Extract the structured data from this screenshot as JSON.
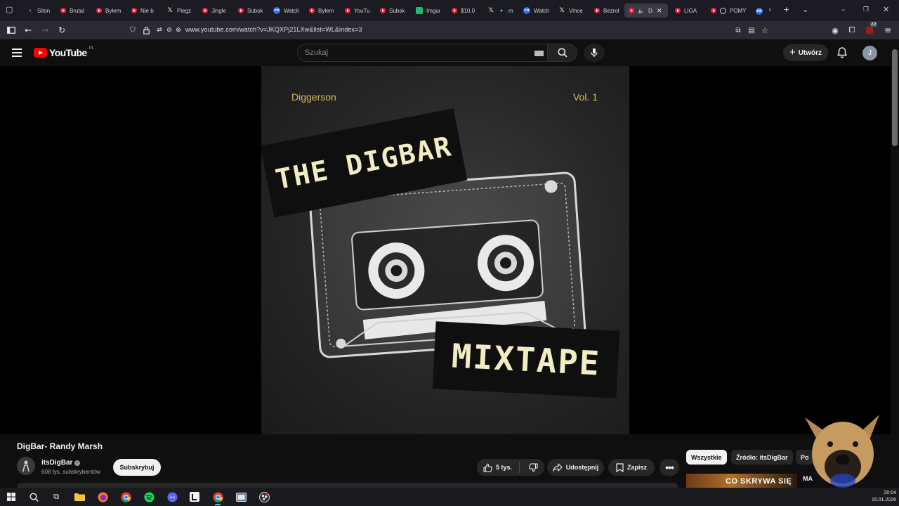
{
  "browser": {
    "tabs": [
      {
        "label": "Siton",
        "icon": "back-chevron"
      },
      {
        "label": "Brutal",
        "icon": "youtube-icon"
      },
      {
        "label": "Byłem",
        "icon": "youtube-icon"
      },
      {
        "label": "Nie b",
        "icon": "youtube-icon"
      },
      {
        "label": "Piegz",
        "icon": "x-icon"
      },
      {
        "label": "Jingle",
        "icon": "youtube-icon"
      },
      {
        "label": "Subsk",
        "icon": "youtube-icon"
      },
      {
        "label": "Watch",
        "icon": "extension-icon"
      },
      {
        "label": "Byłem",
        "icon": "youtube-icon"
      },
      {
        "label": "YouTu",
        "icon": "youtube-icon"
      },
      {
        "label": "Subsk",
        "icon": "youtube-icon"
      },
      {
        "label": "Imgur",
        "icon": "imgur-icon"
      },
      {
        "label": "$10,0",
        "icon": "youtube-icon"
      },
      {
        "label": "m",
        "icon": "x-icon"
      },
      {
        "label": "Watch",
        "icon": "extension-icon"
      },
      {
        "label": "Vince",
        "icon": "x-icon"
      },
      {
        "label": "Bezroł",
        "icon": "youtube-icon"
      },
      {
        "label": "D",
        "icon": "youtube-icon"
      },
      {
        "label": "LIGA",
        "icon": "youtube-icon"
      },
      {
        "label": "POMY",
        "icon": "youtube-icon"
      }
    ],
    "url": "www.youtube.com/watch?v=JKQXPj21LXw&list=WL&index=3",
    "extension_badge": "22"
  },
  "youtube": {
    "logo_text": "YouTube",
    "country_code": "PL",
    "search_placeholder": "Szukaj",
    "create_label": "Utwórz",
    "avatar_letter": "J"
  },
  "artwork": {
    "artist": "Diggerson",
    "volume": "Vol. 1",
    "title_line1": "THE DIGBAR",
    "title_line2": "MIXTAPE"
  },
  "video": {
    "title": "DigBar- Randy Marsh",
    "channel": "itsDigBar",
    "subscribers": "608 tys. subskrybentów",
    "subscribe_label": "Subskrybuj",
    "likes": "5 tys.",
    "share_label": "Udostępnij",
    "save_label": "Zapisz"
  },
  "chips": {
    "all": "Wszystkie",
    "source": "Źródło: itsDigBar",
    "more": "Po"
  },
  "recommended": {
    "thumb_text": "CO SKRYWA SIĘ",
    "text": "MA"
  },
  "taskbar": {
    "time": "20:04",
    "date": "15.01.2026"
  }
}
